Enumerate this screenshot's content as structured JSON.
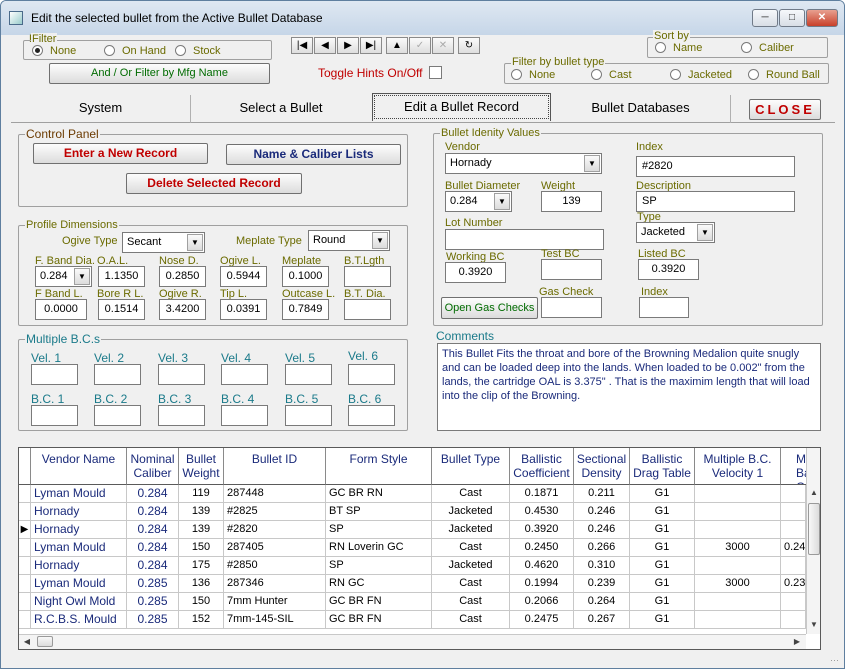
{
  "window": {
    "title": "Edit the selected bullet from the Active Bullet Database"
  },
  "filter": {
    "label": "Filter",
    "options": [
      "None",
      "On Hand",
      "Stock"
    ],
    "selected": "None",
    "mfg_button": "And / Or Filter by Mfg Name"
  },
  "toggle_hints": {
    "label": "Toggle Hints On/Off"
  },
  "sort_by": {
    "label": "Sort by",
    "options": [
      "Name",
      "Caliber"
    ],
    "selected": ""
  },
  "filter_type": {
    "label": "Filter by bullet type",
    "options": [
      "None",
      "Cast",
      "Jacketed",
      "Round Ball"
    ],
    "selected": ""
  },
  "tabs": [
    {
      "label": "System"
    },
    {
      "label": "Select a Bullet"
    },
    {
      "label": "Edit a Bullet Record"
    },
    {
      "label": "Bullet Databases"
    }
  ],
  "close_button": "CLOSE",
  "control_panel": {
    "label": "Control Panel",
    "enter_new": "Enter a New Record",
    "name_caliber": "Name & Caliber Lists",
    "delete": "Delete Selected Record"
  },
  "profile": {
    "label": "Profile Dimensions",
    "ogive_type_label": "Ogive Type",
    "ogive_type": "Secant",
    "meplate_type_label": "Meplate Type",
    "meplate_type": "Round",
    "row1": [
      {
        "label": "F. Band Dia.",
        "value": "0.284"
      },
      {
        "label": "O.A.L.",
        "value": "1.1350"
      },
      {
        "label": "Nose D.",
        "value": "0.2850"
      },
      {
        "label": "Ogive L.",
        "value": "0.5944"
      },
      {
        "label": "Meplate",
        "value": "0.1000"
      },
      {
        "label": "B.T.Lgth",
        "value": ""
      }
    ],
    "row2": [
      {
        "label": "F Band L.",
        "value": "0.0000"
      },
      {
        "label": "Bore R L.",
        "value": "0.1514"
      },
      {
        "label": "Ogive R.",
        "value": "3.4200"
      },
      {
        "label": "Tip L.",
        "value": "0.0391"
      },
      {
        "label": "Outcase L.",
        "value": "0.7849"
      },
      {
        "label": "B.T. Dia.",
        "value": ""
      }
    ]
  },
  "multiple_bc": {
    "label": "Multiple B.C.s",
    "vel": [
      "Vel. 1",
      "Vel. 2",
      "Vel. 3",
      "Vel. 4",
      "Vel. 5",
      "Vel. 6"
    ],
    "bc": [
      "B.C. 1",
      "B.C. 2",
      "B.C. 3",
      "B.C. 4",
      "B.C. 5",
      "B.C. 6"
    ]
  },
  "identity": {
    "label": "Bullet Idenity Values",
    "vendor_label": "Vendor",
    "vendor": "Hornady",
    "index_label": "Index",
    "index": "#2820",
    "diameter_label": "Bullet Diameter",
    "diameter": "0.284",
    "weight_label": "Weight",
    "weight": "139",
    "description_label": "Description",
    "description": "SP",
    "lot_label": "Lot Number",
    "lot": "",
    "type_label": "Type",
    "type": "Jacketed",
    "working_bc_label": "Working BC",
    "working_bc": "0.3920",
    "test_bc_label": "Test BC",
    "test_bc": "",
    "listed_bc_label": "Listed BC",
    "listed_bc": "0.3920",
    "gas_check_button": "Open Gas Checks",
    "gas_check_label": "Gas Check",
    "gas_check": "",
    "index2_label": "Index",
    "index2": ""
  },
  "comments": {
    "label": "Comments",
    "text": "This Bullet Fits the throat and bore of the Browning Medalion quite snugly and can be loaded deep into the lands.  When loaded to be 0.002\" from the lands, the cartridge OAL is 3.375\" . That is the maximim length that will load into the clip of the Browning."
  },
  "grid": {
    "headers": [
      "Vendor Name",
      "Nominal Caliber",
      "Bullet Weight",
      "Bullet ID",
      "Form Style",
      "Bullet Type",
      "Ballistic Coefficient",
      "Sectional Density",
      "Ballistic Drag Table",
      "Multiple B.C. Velocity 1",
      "Mult Bal. C"
    ],
    "rows": [
      [
        "Lyman Mould",
        "0.284",
        "119",
        "287448",
        "GC BR RN",
        "Cast",
        "0.1871",
        "0.211",
        "G1",
        "",
        ""
      ],
      [
        "Hornady",
        "0.284",
        "139",
        "#2825",
        "BT SP",
        "Jacketed",
        "0.4530",
        "0.246",
        "G1",
        "",
        ""
      ],
      [
        "Hornady",
        "0.284",
        "139",
        "#2820",
        "SP",
        "Jacketed",
        "0.3920",
        "0.246",
        "G1",
        "",
        ""
      ],
      [
        "Lyman Mould",
        "0.284",
        "150",
        "287405",
        "RN Loverin GC",
        "Cast",
        "0.2450",
        "0.266",
        "G1",
        "3000",
        "0.24"
      ],
      [
        "Hornady",
        "0.284",
        "175",
        "#2850",
        "SP",
        "Jacketed",
        "0.4620",
        "0.310",
        "G1",
        "",
        ""
      ],
      [
        "Lyman Mould",
        "0.285",
        "136",
        "287346",
        "RN GC",
        "Cast",
        "0.1994",
        "0.239",
        "G1",
        "3000",
        "0.23"
      ],
      [
        "Night Owl Mold",
        "0.285",
        "150",
        "7mm Hunter",
        "GC BR FN",
        "Cast",
        "0.2066",
        "0.264",
        "G1",
        "",
        ""
      ],
      [
        "R.C.B.S. Mould",
        "0.285",
        "152",
        "7mm-145-SIL",
        "GC BR FN",
        "Cast",
        "0.2475",
        "0.267",
        "G1",
        "",
        ""
      ]
    ]
  }
}
